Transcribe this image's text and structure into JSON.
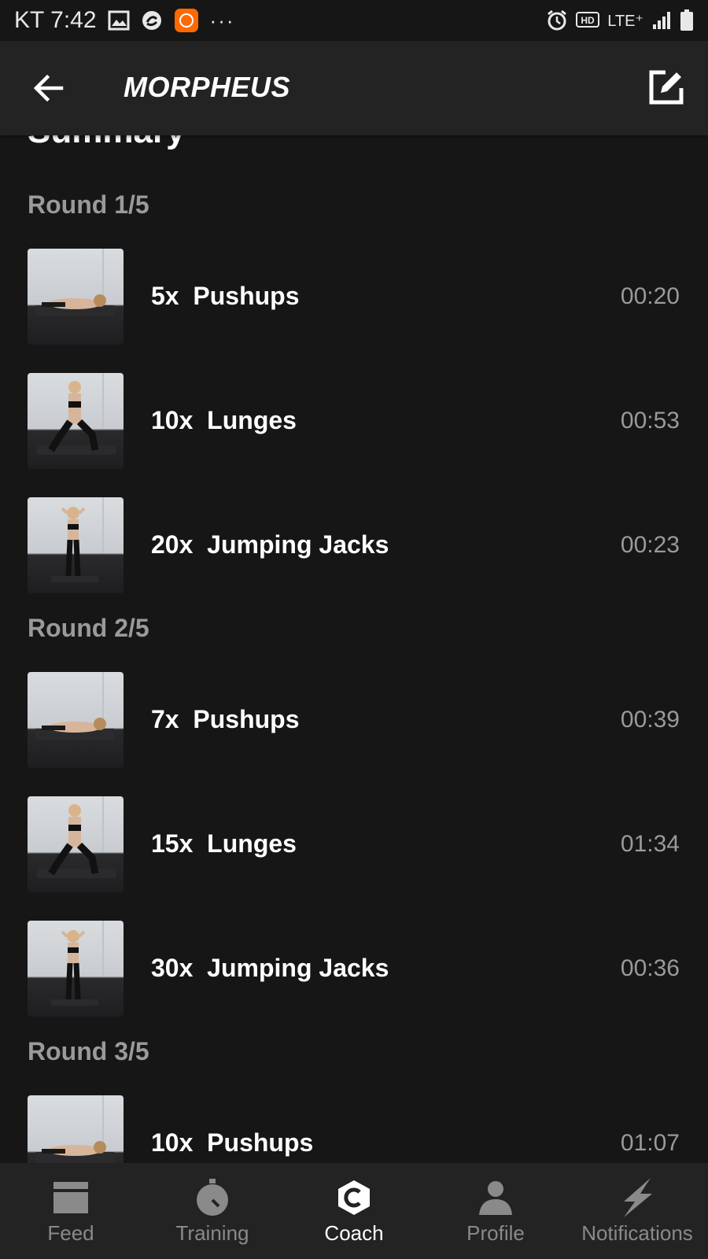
{
  "status_bar": {
    "carrier_time": "KT 7:42",
    "more": "···",
    "network": "LTE⁺"
  },
  "header": {
    "title": "MORPHEUS"
  },
  "summary_peek": "Summary",
  "rounds": [
    {
      "label": "Round 1/5",
      "exercises": [
        {
          "label": "5x  Pushups",
          "time": "00:20",
          "pose": "pushup"
        },
        {
          "label": "10x  Lunges",
          "time": "00:53",
          "pose": "lunge"
        },
        {
          "label": "20x  Jumping Jacks",
          "time": "00:23",
          "pose": "stand"
        }
      ]
    },
    {
      "label": "Round 2/5",
      "exercises": [
        {
          "label": "7x  Pushups",
          "time": "00:39",
          "pose": "pushup"
        },
        {
          "label": "15x  Lunges",
          "time": "01:34",
          "pose": "lunge"
        },
        {
          "label": "30x  Jumping Jacks",
          "time": "00:36",
          "pose": "stand"
        }
      ]
    },
    {
      "label": "Round 3/5",
      "exercises": [
        {
          "label": "10x  Pushups",
          "time": "01:07",
          "pose": "pushup"
        }
      ]
    }
  ],
  "bottom_nav": [
    {
      "label": "Feed",
      "icon": "feed-icon",
      "active": false
    },
    {
      "label": "Training",
      "icon": "stopwatch-icon",
      "active": false
    },
    {
      "label": "Coach",
      "icon": "coach-icon",
      "active": true
    },
    {
      "label": "Profile",
      "icon": "profile-icon",
      "active": false
    },
    {
      "label": "Notifications",
      "icon": "lightning-icon",
      "active": false
    }
  ]
}
